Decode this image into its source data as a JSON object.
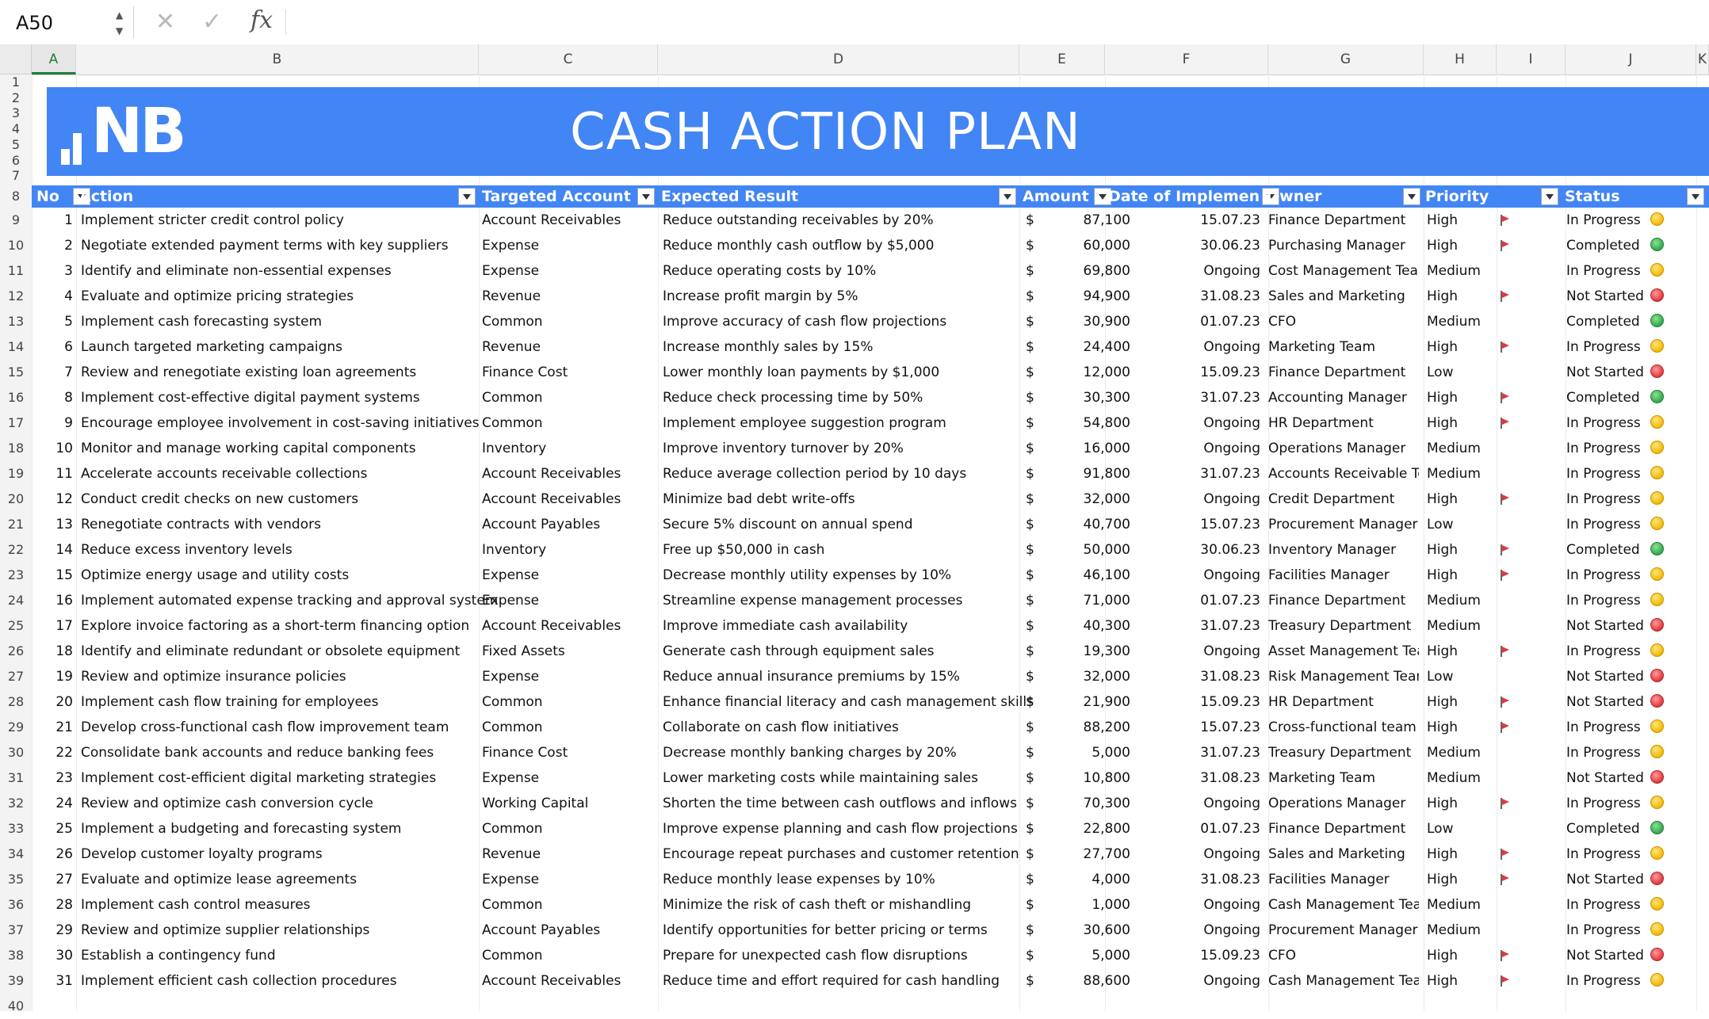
{
  "formula_bar": {
    "name_box": "A50",
    "cancel_icon": "close-icon",
    "enter_icon": "checkmark-icon",
    "function_label": "fx"
  },
  "columns": [
    "A",
    "B",
    "C",
    "D",
    "E",
    "F",
    "G",
    "H",
    "I",
    "J",
    "K"
  ],
  "rows": [
    "1",
    "2",
    "3",
    "4",
    "5",
    "6",
    "7",
    "8",
    "9",
    "10",
    "11",
    "12",
    "13",
    "14",
    "15",
    "16",
    "17",
    "18",
    "19",
    "20",
    "21",
    "22",
    "23",
    "24",
    "25",
    "26",
    "27",
    "28",
    "29",
    "30",
    "31",
    "32",
    "33",
    "34",
    "35",
    "36",
    "37",
    "38",
    "39",
    "40"
  ],
  "banner": {
    "logo_text": "NB",
    "title": "CASH ACTION PLAN",
    "color": "#4285f4"
  },
  "table": {
    "headers": [
      "No",
      "Action",
      "Targeted Account",
      "Expected Result",
      "Amount",
      "Date of Implemen",
      "Owner",
      "Priority",
      "",
      "Status"
    ],
    "currency_symbol": "$",
    "status_colors": {
      "In Progress": "#f5b800",
      "Completed": "#2fa84f",
      "Not Started": "#e0393e"
    },
    "rows": [
      {
        "no": "1",
        "action": "Implement stricter credit control policy",
        "account": "Account Receivables",
        "result": "Reduce outstanding receivables by 20%",
        "amount": "87,100",
        "date": "15.07.23",
        "owner": "Finance Department",
        "priority": "High",
        "flag": true,
        "status": "In Progress"
      },
      {
        "no": "2",
        "action": "Negotiate extended payment terms with key suppliers",
        "account": "Expense",
        "result": "Reduce monthly cash outflow by $5,000",
        "amount": "60,000",
        "date": "30.06.23",
        "owner": "Purchasing Manager",
        "priority": "High",
        "flag": true,
        "status": "Completed"
      },
      {
        "no": "3",
        "action": "Identify and eliminate non-essential expenses",
        "account": "Expense",
        "result": "Reduce operating costs by 10%",
        "amount": "69,800",
        "date": "Ongoing",
        "owner": "Cost Management Team",
        "priority": "Medium",
        "flag": false,
        "status": "In Progress"
      },
      {
        "no": "4",
        "action": "Evaluate and optimize pricing strategies",
        "account": "Revenue",
        "result": "Increase profit margin by 5%",
        "amount": "94,900",
        "date": "31.08.23",
        "owner": "Sales and Marketing",
        "priority": "High",
        "flag": true,
        "status": "Not Started"
      },
      {
        "no": "5",
        "action": "Implement cash forecasting system",
        "account": "Common",
        "result": "Improve accuracy of cash flow projections",
        "amount": "30,900",
        "date": "01.07.23",
        "owner": "CFO",
        "priority": "Medium",
        "flag": false,
        "status": "Completed"
      },
      {
        "no": "6",
        "action": "Launch targeted marketing campaigns",
        "account": "Revenue",
        "result": "Increase monthly sales by 15%",
        "amount": "24,400",
        "date": "Ongoing",
        "owner": "Marketing Team",
        "priority": "High",
        "flag": true,
        "status": "In Progress"
      },
      {
        "no": "7",
        "action": "Review and renegotiate existing loan agreements",
        "account": "Finance Cost",
        "result": "Lower monthly loan payments by $1,000",
        "amount": "12,000",
        "date": "15.09.23",
        "owner": "Finance Department",
        "priority": "Low",
        "flag": false,
        "status": "Not Started"
      },
      {
        "no": "8",
        "action": "Implement cost-effective digital payment systems",
        "account": "Common",
        "result": "Reduce check processing time by 50%",
        "amount": "30,300",
        "date": "31.07.23",
        "owner": "Accounting Manager",
        "priority": "High",
        "flag": true,
        "status": "Completed"
      },
      {
        "no": "9",
        "action": "Encourage employee involvement in cost-saving initiatives",
        "account": "Common",
        "result": "Implement employee suggestion program",
        "amount": "54,800",
        "date": "Ongoing",
        "owner": "HR Department",
        "priority": "High",
        "flag": true,
        "status": "In Progress"
      },
      {
        "no": "10",
        "action": "Monitor and manage working capital components",
        "account": "Inventory",
        "result": "Improve inventory turnover by 20%",
        "amount": "16,000",
        "date": "Ongoing",
        "owner": "Operations Manager",
        "priority": "Medium",
        "flag": false,
        "status": "In Progress"
      },
      {
        "no": "11",
        "action": "Accelerate accounts receivable collections",
        "account": "Account Receivables",
        "result": "Reduce average collection period by 10 days",
        "amount": "91,800",
        "date": "31.07.23",
        "owner": "Accounts Receivable Team",
        "priority": "Medium",
        "flag": false,
        "status": "In Progress"
      },
      {
        "no": "12",
        "action": "Conduct credit checks on new customers",
        "account": "Account Receivables",
        "result": "Minimize bad debt write-offs",
        "amount": "32,000",
        "date": "Ongoing",
        "owner": "Credit Department",
        "priority": "High",
        "flag": true,
        "status": "In Progress"
      },
      {
        "no": "13",
        "action": "Renegotiate contracts with vendors",
        "account": "Account Payables",
        "result": "Secure 5% discount on annual spend",
        "amount": "40,700",
        "date": "15.07.23",
        "owner": "Procurement Manager",
        "priority": "Low",
        "flag": false,
        "status": "In Progress"
      },
      {
        "no": "14",
        "action": "Reduce excess inventory levels",
        "account": "Inventory",
        "result": "Free up $50,000 in cash",
        "amount": "50,000",
        "date": "30.06.23",
        "owner": "Inventory Manager",
        "priority": "High",
        "flag": true,
        "status": "Completed"
      },
      {
        "no": "15",
        "action": "Optimize energy usage and utility costs",
        "account": "Expense",
        "result": "Decrease monthly utility expenses by 10%",
        "amount": "46,100",
        "date": "Ongoing",
        "owner": "Facilities Manager",
        "priority": "High",
        "flag": true,
        "status": "In Progress"
      },
      {
        "no": "16",
        "action": "Implement automated expense tracking and approval system",
        "account": "Expense",
        "result": "Streamline expense management processes",
        "amount": "71,000",
        "date": "01.07.23",
        "owner": "Finance Department",
        "priority": "Medium",
        "flag": false,
        "status": "In Progress"
      },
      {
        "no": "17",
        "action": "Explore invoice factoring as a short-term financing option",
        "account": "Account Receivables",
        "result": "Improve immediate cash availability",
        "amount": "40,300",
        "date": "31.07.23",
        "owner": "Treasury Department",
        "priority": "Medium",
        "flag": false,
        "status": "Not Started"
      },
      {
        "no": "18",
        "action": "Identify and eliminate redundant or obsolete equipment",
        "account": "Fixed Assets",
        "result": "Generate cash through equipment sales",
        "amount": "19,300",
        "date": "Ongoing",
        "owner": "Asset Management Team",
        "priority": "High",
        "flag": true,
        "status": "In Progress"
      },
      {
        "no": "19",
        "action": "Review and optimize insurance policies",
        "account": "Expense",
        "result": "Reduce annual insurance premiums by 15%",
        "amount": "32,000",
        "date": "31.08.23",
        "owner": "Risk Management Team",
        "priority": "Low",
        "flag": false,
        "status": "Not Started"
      },
      {
        "no": "20",
        "action": "Implement cash flow training for employees",
        "account": "Common",
        "result": "Enhance financial literacy and cash management skills",
        "amount": "21,900",
        "date": "15.09.23",
        "owner": "HR Department",
        "priority": "High",
        "flag": true,
        "status": "Not Started"
      },
      {
        "no": "21",
        "action": "Develop cross-functional cash flow improvement team",
        "account": "Common",
        "result": "Collaborate on cash flow initiatives",
        "amount": "88,200",
        "date": "15.07.23",
        "owner": "Cross-functional team",
        "priority": "High",
        "flag": true,
        "status": "In Progress"
      },
      {
        "no": "22",
        "action": "Consolidate bank accounts and reduce banking fees",
        "account": "Finance Cost",
        "result": "Decrease monthly banking charges by 20%",
        "amount": "5,000",
        "date": "31.07.23",
        "owner": "Treasury Department",
        "priority": "Medium",
        "flag": false,
        "status": "In Progress"
      },
      {
        "no": "23",
        "action": "Implement cost-efficient digital marketing strategies",
        "account": "Expense",
        "result": "Lower marketing costs while maintaining sales",
        "amount": "10,800",
        "date": "31.08.23",
        "owner": "Marketing Team",
        "priority": "Medium",
        "flag": false,
        "status": "Not Started"
      },
      {
        "no": "24",
        "action": "Review and optimize cash conversion cycle",
        "account": "Working Capital",
        "result": "Shorten the time between cash outflows and inflows",
        "amount": "70,300",
        "date": "Ongoing",
        "owner": "Operations Manager",
        "priority": "High",
        "flag": true,
        "status": "In Progress"
      },
      {
        "no": "25",
        "action": "Implement a budgeting and forecasting system",
        "account": "Common",
        "result": "Improve expense planning and cash flow projections",
        "amount": "22,800",
        "date": "01.07.23",
        "owner": "Finance Department",
        "priority": "Low",
        "flag": false,
        "status": "Completed"
      },
      {
        "no": "26",
        "action": "Develop customer loyalty programs",
        "account": "Revenue",
        "result": "Encourage repeat purchases and customer retention",
        "amount": "27,700",
        "date": "Ongoing",
        "owner": "Sales and Marketing",
        "priority": "High",
        "flag": true,
        "status": "In Progress"
      },
      {
        "no": "27",
        "action": "Evaluate and optimize lease agreements",
        "account": "Expense",
        "result": "Reduce monthly lease expenses by 10%",
        "amount": "4,000",
        "date": "31.08.23",
        "owner": "Facilities Manager",
        "priority": "High",
        "flag": true,
        "status": "Not Started"
      },
      {
        "no": "28",
        "action": "Implement cash control measures",
        "account": "Common",
        "result": "Minimize the risk of cash theft or mishandling",
        "amount": "1,000",
        "date": "Ongoing",
        "owner": "Cash Management Team",
        "priority": "Medium",
        "flag": false,
        "status": "In Progress"
      },
      {
        "no": "29",
        "action": "Review and optimize supplier relationships",
        "account": "Account Payables",
        "result": "Identify opportunities for better pricing or terms",
        "amount": "30,600",
        "date": "Ongoing",
        "owner": "Procurement Manager",
        "priority": "Medium",
        "flag": false,
        "status": "In Progress"
      },
      {
        "no": "30",
        "action": "Establish a contingency fund",
        "account": "Common",
        "result": "Prepare for unexpected cash flow disruptions",
        "amount": "5,000",
        "date": "15.09.23",
        "owner": "CFO",
        "priority": "High",
        "flag": true,
        "status": "Not Started"
      },
      {
        "no": "31",
        "action": "Implement efficient cash collection procedures",
        "account": "Account Receivables",
        "result": "Reduce time and effort required for cash handling",
        "amount": "88,600",
        "date": "Ongoing",
        "owner": "Cash Management Team",
        "priority": "High",
        "flag": true,
        "status": "In Progress"
      }
    ]
  }
}
